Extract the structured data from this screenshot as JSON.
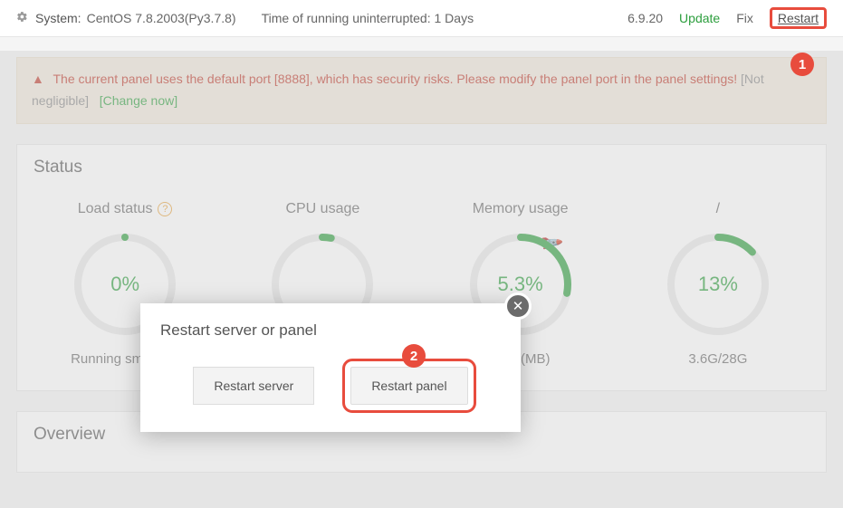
{
  "topbar": {
    "system_label": "System:",
    "system_value": "CentOS 7.8.2003(Py3.7.8)",
    "uptime": "Time of running uninterrupted: 1 Days",
    "version": "6.9.20",
    "update": "Update",
    "fix": "Fix",
    "restart": "Restart"
  },
  "alert": {
    "text_red": "The current panel uses the default port [8888], which has security risks. Please modify the panel port in the panel settings!",
    "not_negligible": "[Not negligible]",
    "change_now": "[Change now]"
  },
  "status": {
    "title": "Status",
    "gauges": [
      {
        "label": "Load status",
        "help": true,
        "value_text": "0%",
        "percent": 0,
        "sub": "Running smoothly"
      },
      {
        "label": "CPU usage",
        "help": false,
        "value_text": "",
        "percent": 3,
        "sub": ""
      },
      {
        "label": "Memory usage",
        "help": false,
        "value_text": "5.3%",
        "percent": 28,
        "sub": "3788(MB)",
        "rocket": true
      },
      {
        "label": "/",
        "help": false,
        "value_text": "13%",
        "percent": 13,
        "sub": "3.6G/28G"
      }
    ]
  },
  "overview": {
    "title": "Overview"
  },
  "modal": {
    "title": "Restart server or panel",
    "restart_server": "Restart server",
    "restart_panel": "Restart panel"
  },
  "callouts": {
    "one": "1",
    "two": "2"
  }
}
